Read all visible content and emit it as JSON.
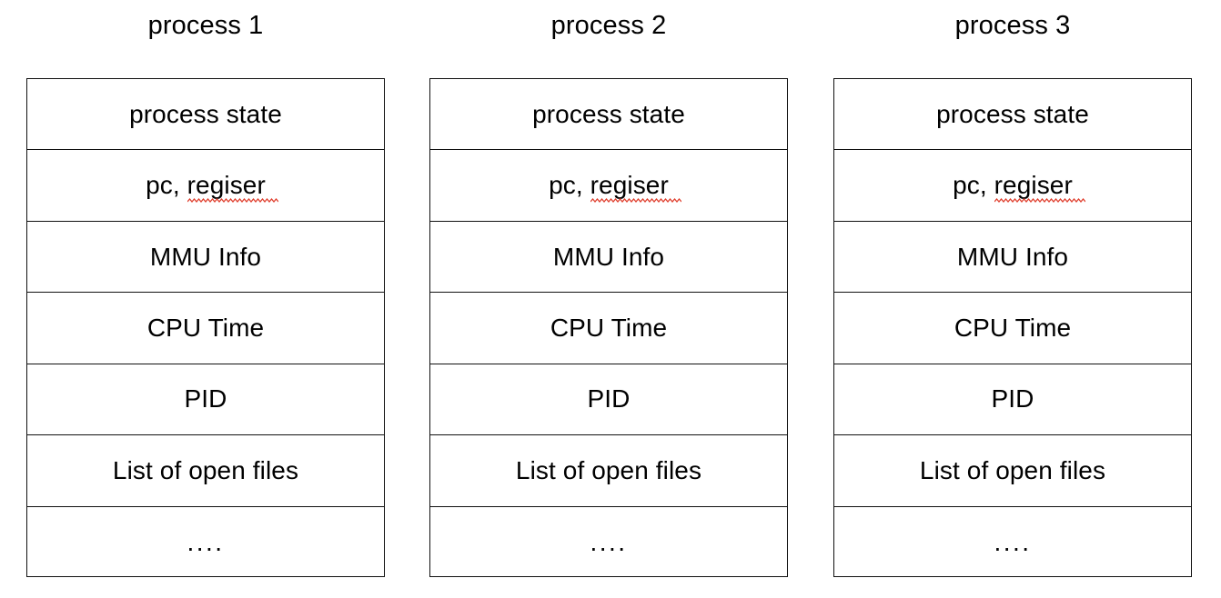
{
  "diagram": {
    "title_row": [
      "process 1",
      "process 2",
      "process 3"
    ],
    "columns": [
      {
        "title": "process 1",
        "rows": [
          {
            "label": "process state"
          },
          {
            "label_prefix": "pc, ",
            "label_misspelled": "regiser",
            "misspelled": true
          },
          {
            "label": "MMU Info"
          },
          {
            "label": "CPU Time"
          },
          {
            "label": "PID"
          },
          {
            "label": "List of open files"
          },
          {
            "label": "...."
          }
        ]
      },
      {
        "title": "process 2",
        "rows": [
          {
            "label": "process state"
          },
          {
            "label_prefix": "pc, ",
            "label_misspelled": "regiser",
            "misspelled": true
          },
          {
            "label": "MMU Info"
          },
          {
            "label": "CPU Time"
          },
          {
            "label": "PID"
          },
          {
            "label": "List of open files"
          },
          {
            "label": "...."
          }
        ]
      },
      {
        "title": "process 3",
        "rows": [
          {
            "label": "process state"
          },
          {
            "label_prefix": "pc, ",
            "label_misspelled": "regiser",
            "misspelled": true
          },
          {
            "label": "MMU Info"
          },
          {
            "label": "CPU Time"
          },
          {
            "label": "PID"
          },
          {
            "label": "List of open files"
          },
          {
            "label": "...."
          }
        ]
      }
    ],
    "colors": {
      "background": "#ffffff",
      "border": "#111111",
      "text": "#000000",
      "spellcheck_squiggle": "#e0402f"
    }
  }
}
